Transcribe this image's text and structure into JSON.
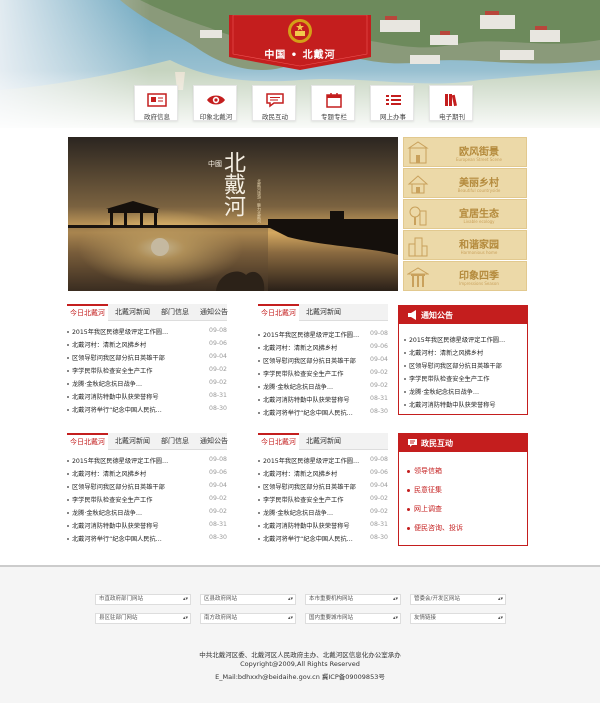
{
  "header": {
    "site_title": "中国 • 北戴河",
    "colors": {
      "brand_red": "#c41e1e",
      "gold": "#ecd9a8"
    },
    "nav": [
      {
        "label": "政府信息",
        "icon": "document-icon"
      },
      {
        "label": "印象北戴河",
        "icon": "eye-icon"
      },
      {
        "label": "政民互动",
        "icon": "chat-icon"
      },
      {
        "label": "专题专栏",
        "icon": "calendar-icon"
      },
      {
        "label": "网上办事",
        "icon": "list-icon"
      },
      {
        "label": "电子期刊",
        "icon": "books-icon"
      }
    ]
  },
  "banner": {
    "calligraphy_small": "中國",
    "calligraphy_main": "北戴河",
    "caption": "北戴河旅游 · 魅力北戴河"
  },
  "feature_tiles": [
    {
      "title": "欧风街景",
      "subtitle": "European Street Scene",
      "icon": "building-icon"
    },
    {
      "title": "美丽乡村",
      "subtitle": "Beautiful countryside",
      "icon": "house-icon"
    },
    {
      "title": "宜居生态",
      "subtitle": "Livable ecology",
      "icon": "tree-icon"
    },
    {
      "title": "和谐家园",
      "subtitle": "Harmonious home",
      "icon": "city-icon"
    },
    {
      "title": "印象四季",
      "subtitle": "Impressions Season",
      "icon": "pavilion-icon"
    }
  ],
  "panels": [
    {
      "tabs": [
        "今日北戴河",
        "北戴河新闻",
        "部门信息",
        "通知公告"
      ],
      "items": [
        {
          "title": "2015年我区民德星级评定工作圆…",
          "date": "09-08"
        },
        {
          "title": "北戴河村：清新之风拂乡村",
          "date": "09-06"
        },
        {
          "title": "区领导慰问我区部分抗日英雄干部",
          "date": "09-04"
        },
        {
          "title": "李学民带队检查安全生产工作",
          "date": "09-02"
        },
        {
          "title": "龙腾·金秋纪念抗日战争…",
          "date": "09-02"
        },
        {
          "title": "北戴河消防特勤中队获荣誉称号",
          "date": "08-31"
        },
        {
          "title": "北戴河将举行“纪念中国人民抗…",
          "date": "08-30"
        }
      ]
    },
    {
      "tabs": [
        "今日北戴河",
        "北戴河新闻"
      ],
      "items": [
        {
          "title": "2015年我区民德星级评定工作圆…",
          "date": "09-08"
        },
        {
          "title": "北戴河村：清新之风拂乡村",
          "date": "09-06"
        },
        {
          "title": "区领导慰问我区部分抗日英雄干部",
          "date": "09-04"
        },
        {
          "title": "李学民带队检查安全生产工作",
          "date": "09-02"
        },
        {
          "title": "龙腾·金秋纪念抗日战争…",
          "date": "09-02"
        },
        {
          "title": "北戴河消防特勤中队获荣誉称号",
          "date": "08-31"
        },
        {
          "title": "北戴河将举行“纪念中国人民抗…",
          "date": "08-30"
        }
      ]
    },
    {
      "tabs": [
        "今日北戴河",
        "北戴河新闻",
        "部门信息",
        "通知公告"
      ],
      "items": [
        {
          "title": "2015年我区民德星级评定工作圆…",
          "date": "09-08"
        },
        {
          "title": "北戴河村：清新之风拂乡村",
          "date": "09-06"
        },
        {
          "title": "区领导慰问我区部分抗日英雄干部",
          "date": "09-04"
        },
        {
          "title": "李学民带队检查安全生产工作",
          "date": "09-02"
        },
        {
          "title": "龙腾·金秋纪念抗日战争…",
          "date": "09-02"
        },
        {
          "title": "北戴河消防特勤中队获荣誉称号",
          "date": "08-31"
        },
        {
          "title": "北戴河将举行“纪念中国人民抗…",
          "date": "08-30"
        }
      ]
    },
    {
      "tabs": [
        "今日北戴河",
        "北戴河新闻"
      ],
      "items": [
        {
          "title": "2015年我区民德星级评定工作圆…",
          "date": "09-08"
        },
        {
          "title": "北戴河村：清新之风拂乡村",
          "date": "09-06"
        },
        {
          "title": "区领导慰问我区部分抗日英雄干部",
          "date": "09-04"
        },
        {
          "title": "李学民带队检查安全生产工作",
          "date": "09-02"
        },
        {
          "title": "龙腾·金秋纪念抗日战争…",
          "date": "09-02"
        },
        {
          "title": "北戴河消防特勤中队获荣誉称号",
          "date": "08-31"
        },
        {
          "title": "北戴河将举行“纪念中国人民抗…",
          "date": "08-30"
        }
      ]
    }
  ],
  "notice": {
    "title": "通知公告",
    "items": [
      "2015年我区民德星级评定工作圆…",
      "北戴河村：清新之风拂乡村",
      "区领导慰问我区部分抗日英雄干部",
      "李学民带队检查安全生产工作",
      "龙腾·金秋纪念抗日战争…",
      "北戴河消防特勤中队获荣誉称号"
    ]
  },
  "interaction": {
    "title": "政民互动",
    "items": [
      "领导信箱",
      "民意征集",
      "网上调查",
      "便民咨询、投诉"
    ]
  },
  "footer": {
    "selects": [
      "市直政府部门网站",
      "区县政府网站",
      "本市重要机构网站",
      "管委会/开发区网站",
      "县区驻部门网站",
      "南方政府网站",
      "国内重要城市网站",
      "友情链接"
    ],
    "lines": [
      "中共北戴河区委、北戴河区人民政府主办、北戴河区信息化办公室承办",
      "Copyright@2009,All Rights Reserved",
      "E_Mail:bdhxxh@beidaihe.gov.cn 冀ICP备09009853号"
    ]
  }
}
